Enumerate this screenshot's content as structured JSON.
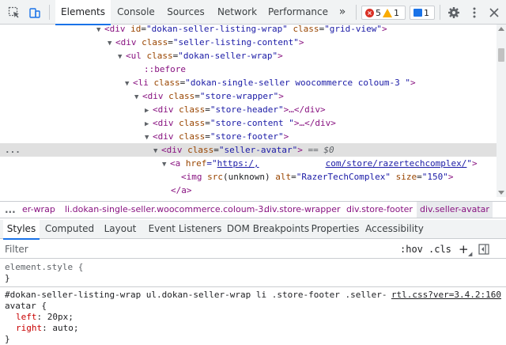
{
  "toolbar": {
    "tabs": [
      "Elements",
      "Console",
      "Sources",
      "Network",
      "Performance"
    ],
    "more_tabs": "»",
    "error_count": "5",
    "warning_count": "1",
    "message_count": "1"
  },
  "dom": {
    "rows": [
      {
        "open": "<div",
        "a1": "id",
        "v1": "\"dokan-seller-listing-wrap\"",
        "a2": "class",
        "v2": "\"grid-view\"",
        "close": ">"
      },
      {
        "open": "<div",
        "a1": "class",
        "v1": "\"seller-listing-content\"",
        "close": ">"
      },
      {
        "open": "<ul",
        "a1": "class",
        "v1": "\"dokan-seller-wrap\"",
        "close": ">"
      },
      {
        "pseudo": "::before"
      },
      {
        "open": "<li",
        "a1": "class",
        "v1": "\"dokan-single-seller woocommerce coloum-3 \"",
        "close": ">"
      },
      {
        "open": "<div",
        "a1": "class",
        "v1": "\"store-wrapper\"",
        "close": ">"
      },
      {
        "open": "<div",
        "a1": "class",
        "v1": "\"store-header\"",
        "close": ">…</div>"
      },
      {
        "open": "<div",
        "a1": "class",
        "v1": "\"store-content \"",
        "close": ">…</div>"
      },
      {
        "open": "<div",
        "a1": "class",
        "v1": "\"store-footer\"",
        "close": ">"
      },
      {
        "open": "<div",
        "a1": "class",
        "v1": "\"seller-avatar\"",
        "close": ">",
        "eq": " == $0"
      },
      {
        "open": "<a",
        "a1": "href",
        "v1_pre": "=\"",
        "link1": "https:/,",
        "link2": "com/store/razertechcomplex/",
        "v1_post": "\"",
        "close": ">"
      },
      {
        "open": "<img",
        "a1": "src",
        "v1": "(unknown)",
        "a2": "alt",
        "v2": "\"RazerTechComplex\"",
        "a3": "size",
        "v3": "\"150\"",
        "close": ">"
      },
      {
        "open": "</a",
        "close": ">"
      }
    ],
    "ellipsis": "..."
  },
  "breadcrumbs": {
    "more": "...",
    "items": [
      "er-wrap",
      "li.dokan-single-seller.woocommerce.coloum-3.",
      "div.store-wrapper",
      "div.store-footer",
      "div.seller-avatar"
    ]
  },
  "panel_tabs": [
    "Styles",
    "Computed",
    "Layout",
    "Event Listeners",
    "DOM Breakpoints",
    "Properties",
    "Accessibility"
  ],
  "filter": {
    "placeholder": "Filter",
    "hov": ":hov",
    "cls": ".cls",
    "plus": "+"
  },
  "styles": {
    "element_style": "element.style {",
    "element_close": "}",
    "rule_selector_1": "#dokan-seller-listing-wrap ul.dokan-seller-wrap li .store-footer .seller-",
    "rule_selector_2": "avatar {",
    "rule_source": "rtl.css?ver=3.4.2:160",
    "props": [
      {
        "name": "left",
        "value": "20px;"
      },
      {
        "name": "right",
        "value": "auto;"
      }
    ],
    "rule_close": "}"
  }
}
